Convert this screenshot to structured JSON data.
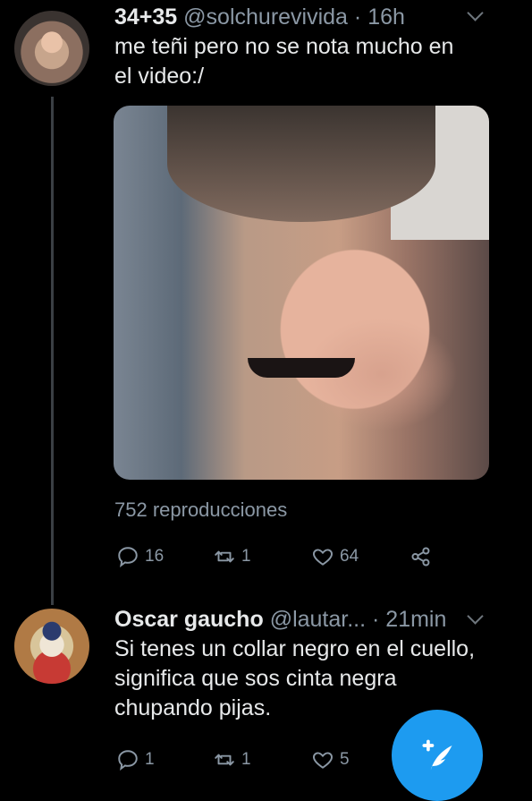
{
  "tweets": [
    {
      "name": "34+35",
      "handle": "@solchurevivida",
      "separator": "·",
      "time": "16h",
      "text": "me teñi pero no se nota mucho en\nel video:/",
      "views": "752 reproducciones",
      "replies": "16",
      "retweets": "1",
      "likes": "64"
    },
    {
      "name": "Oscar gaucho",
      "handle": "@lautar...",
      "separator": "·",
      "time": "21min",
      "text": "Si tenes un collar negro en el cuello,\nsignifica que sos cinta negra\nchupando pijas.",
      "replies": "1",
      "retweets": "1",
      "likes": "5"
    }
  ],
  "icons": {
    "reply": "reply-icon",
    "retweet": "retweet-icon",
    "like": "heart-icon",
    "share": "share-icon",
    "more": "chevron-down-icon",
    "compose": "compose-icon"
  },
  "colors": {
    "background": "#000000",
    "accent": "#1d9bf0",
    "muted": "#8b98a5"
  }
}
